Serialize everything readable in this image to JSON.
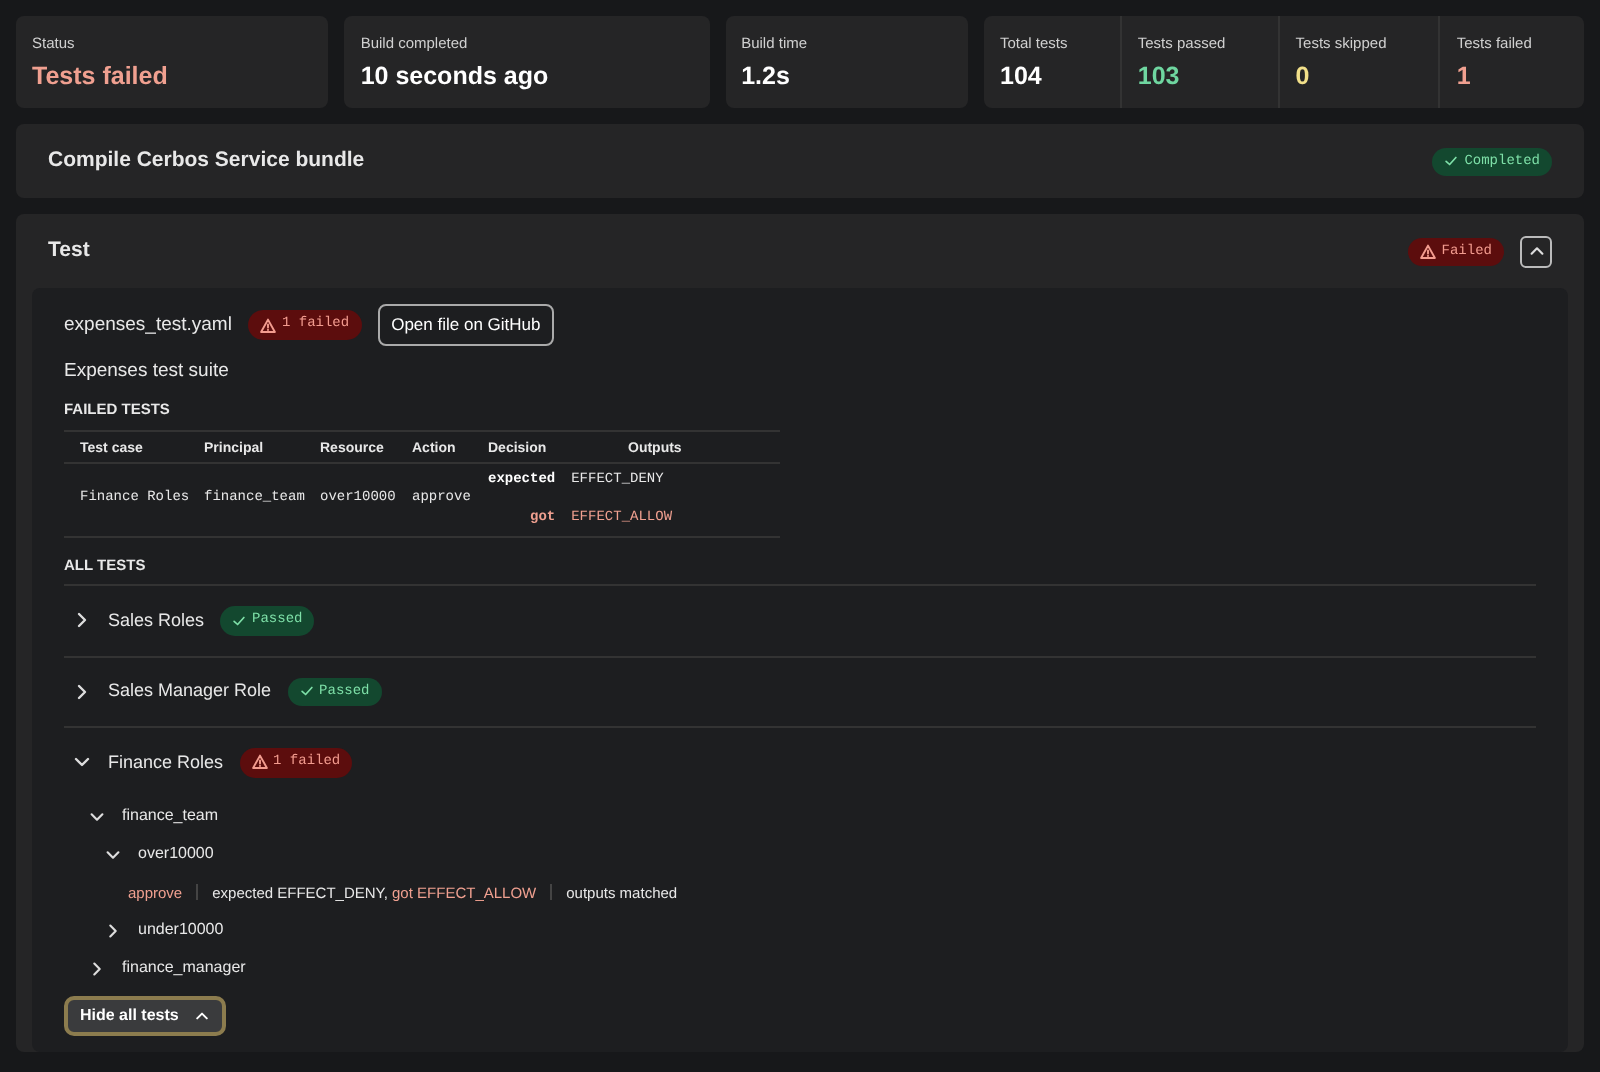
{
  "summary": [
    {
      "label": "Status",
      "value": "Tests failed",
      "color": "#f0a090"
    },
    {
      "label": "Build completed",
      "value": "10 seconds ago",
      "color": "#ffffff"
    },
    {
      "label": "Build time",
      "value": "1.2s",
      "color": "#ffffff"
    }
  ],
  "counts": [
    {
      "label": "Total tests",
      "value": "104",
      "color": "#ffffff"
    },
    {
      "label": "Tests passed",
      "value": "103",
      "color": "#6fd6a0"
    },
    {
      "label": "Tests skipped",
      "value": "0",
      "color": "#f2e08a"
    },
    {
      "label": "Tests failed",
      "value": "1",
      "color": "#f0a090"
    }
  ],
  "steps": [
    {
      "title": "Compile Cerbos Service bundle",
      "status": {
        "label": "Completed",
        "kind": "success"
      }
    },
    {
      "title": "Test",
      "status": {
        "label": "Failed",
        "kind": "danger"
      },
      "expanded": true,
      "suite": {
        "file": "expenses_test.yaml",
        "badge": {
          "text": "1 failed",
          "kind": "danger"
        },
        "github_button": "Open file on GitHub",
        "description": "Expenses test suite",
        "failed_title": "FAILED TESTS",
        "columns": [
          "Test case",
          "Principal",
          "Resource",
          "Action",
          "Decision",
          "Outputs"
        ],
        "rows": [
          {
            "test_case": "Finance Roles",
            "principal": "finance_team",
            "resource": "over10000",
            "action": "approve",
            "decision": [
              {
                "label": "expected",
                "value": "EFFECT_DENY",
                "kind": "expected"
              },
              {
                "label": "got",
                "value": "EFFECT_ALLOW",
                "kind": "got"
              }
            ]
          }
        ],
        "all_title": "ALL TESTS",
        "tests": [
          {
            "kind": "node",
            "label": "Sales Roles",
            "expanded": false,
            "badge": {
              "text": "Passed",
              "kind": "success"
            }
          },
          {
            "kind": "node",
            "label": "Sales Manager Role",
            "expanded": false,
            "badge": {
              "text": "Passed",
              "kind": "success"
            }
          },
          {
            "kind": "node",
            "label": "Finance Roles",
            "expanded": true,
            "badge": {
              "text": "1 failed",
              "kind": "danger"
            },
            "children": [
              {
                "kind": "node",
                "label": "finance_team",
                "expanded": true,
                "children": [
                  {
                    "kind": "node",
                    "label": "over10000",
                    "expanded": true,
                    "children": [
                      {
                        "kind": "result",
                        "action": "approve",
                        "expected": "expected EFFECT_DENY,",
                        "got": "got EFFECT_ALLOW",
                        "outputs": "outputs matched"
                      }
                    ]
                  },
                  {
                    "kind": "node",
                    "label": "under10000",
                    "expanded": false
                  }
                ]
              },
              {
                "kind": "node",
                "label": "finance_manager",
                "expanded": false
              }
            ]
          }
        ],
        "toggle_button": "Hide all tests"
      }
    }
  ]
}
